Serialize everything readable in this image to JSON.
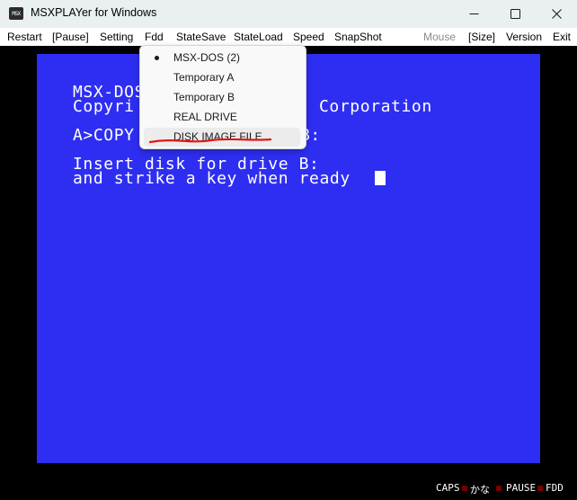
{
  "window": {
    "title": "MSXPLAYer for Windows",
    "app_icon_text": "MSX"
  },
  "menu": {
    "items": [
      "Restart",
      "[Pause]",
      "Setting",
      "Fdd",
      "StateSave",
      "StateLoad",
      "Speed",
      "SnapShot",
      "Mouse",
      "[Size]",
      "Version",
      "Exit"
    ],
    "disabled": [
      "Mouse"
    ]
  },
  "fdd_menu": {
    "items": [
      "MSX-DOS (2)",
      "Temporary A",
      "Temporary B",
      "REAL DRIVE",
      "DISK IMAGE FILE"
    ],
    "checked": "MSX-DOS (2)",
    "highlighted": "DISK IMAGE FILE"
  },
  "msx_screen": {
    "lines": [
      "MSX-DOS",
      "Copyri",
      "A>COPY",
      "Insert disk for drive B:",
      "and strike a key when ready"
    ],
    "partial_right": [
      "Corporation",
      "B:"
    ],
    "background_color": "#2e2ef2",
    "text_color": "#ffffff"
  },
  "status_bar": {
    "indicators": [
      "CAPS",
      "かな",
      "PAUSE",
      "FDD"
    ],
    "led_color": "#7a0000"
  },
  "colors": {
    "underline_annotation": "#e01818"
  }
}
